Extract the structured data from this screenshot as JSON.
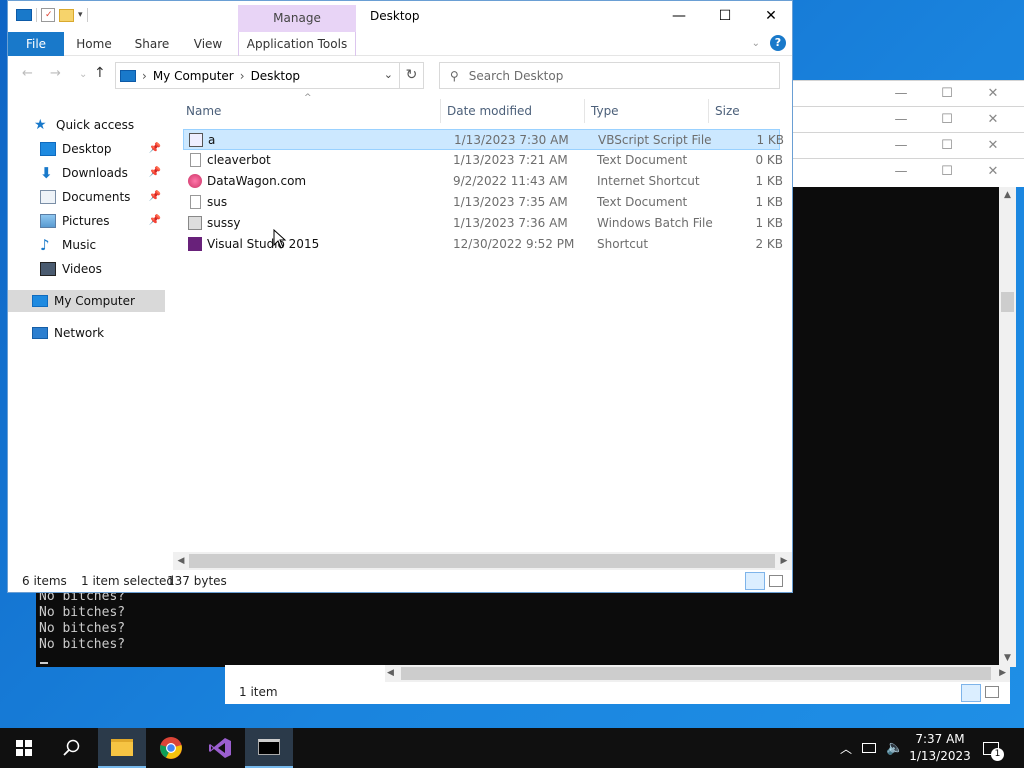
{
  "window": {
    "title": "Desktop",
    "context_tab": "Manage",
    "minimize": "—",
    "maximize": "☐",
    "close": "✕"
  },
  "ribbon": {
    "tabs": [
      "File",
      "Home",
      "Share",
      "View",
      "Application Tools"
    ]
  },
  "address": {
    "segments": [
      "My Computer",
      "Desktop"
    ],
    "separator": "›"
  },
  "search": {
    "placeholder": "Search Desktop"
  },
  "nav": {
    "items": [
      {
        "label": "Quick access",
        "icon": "star-icon"
      },
      {
        "label": "Desktop",
        "icon": "desktop-folder-icon",
        "pinned": true
      },
      {
        "label": "Downloads",
        "icon": "download-arrow-icon",
        "pinned": true
      },
      {
        "label": "Documents",
        "icon": "documents-icon",
        "pinned": true
      },
      {
        "label": "Pictures",
        "icon": "pictures-icon",
        "pinned": true
      },
      {
        "label": "Music",
        "icon": "music-note-icon"
      },
      {
        "label": "Videos",
        "icon": "videos-icon"
      },
      {
        "label": "My Computer",
        "icon": "computer-icon",
        "selected": true
      },
      {
        "label": "Network",
        "icon": "network-icon"
      }
    ]
  },
  "columns": {
    "name": "Name",
    "date": "Date modified",
    "type": "Type",
    "size": "Size"
  },
  "files": [
    {
      "name": "a",
      "date": "1/13/2023 7:30 AM",
      "type": "VBScript Script File",
      "size": "1 KB",
      "icon": "vbscript-icon",
      "selected": true
    },
    {
      "name": "cleaverbot",
      "date": "1/13/2023 7:21 AM",
      "type": "Text Document",
      "size": "0 KB",
      "icon": "text-file-icon"
    },
    {
      "name": "DataWagon.com",
      "date": "9/2/2022 11:43 AM",
      "type": "Internet Shortcut",
      "size": "1 KB",
      "icon": "internet-shortcut-icon"
    },
    {
      "name": "sus",
      "date": "1/13/2023 7:35 AM",
      "type": "Text Document",
      "size": "1 KB",
      "icon": "text-file-icon"
    },
    {
      "name": "sussy",
      "date": "1/13/2023 7:36 AM",
      "type": "Windows Batch File",
      "size": "1 KB",
      "icon": "batch-file-icon"
    },
    {
      "name": "Visual Studio 2015",
      "date": "12/30/2022 9:52 PM",
      "type": "Shortcut",
      "size": "2 KB",
      "icon": "visual-studio-icon"
    }
  ],
  "status": {
    "count": "6 items",
    "selected": "1 item selected",
    "bytes": "137 bytes"
  },
  "console": {
    "lines": [
      "No bitches?",
      "No bitches?",
      "No bitches?",
      "No bitches?"
    ]
  },
  "explorer2": {
    "status": "1 item"
  },
  "clock": {
    "time": "7:37 AM",
    "date": "1/13/2023"
  },
  "tray": {
    "notification_count": "1"
  },
  "colors": {
    "accent": "#1979ca",
    "selection": "#cce8ff",
    "manage_tab": "#e8d4f6"
  }
}
